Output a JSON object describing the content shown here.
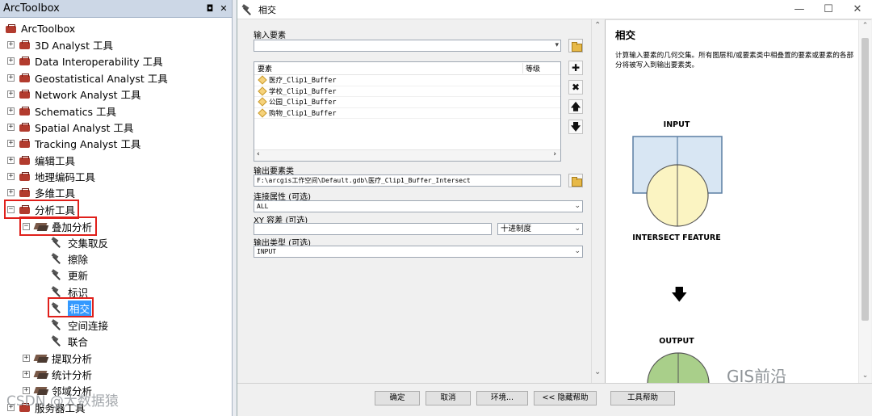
{
  "toolbox": {
    "title": "ArcToolbox",
    "title_buttons": [
      "◘",
      "✕"
    ],
    "root": "ArcToolbox",
    "items": [
      "3D Analyst 工具",
      "Data Interoperability 工具",
      "Geostatistical Analyst 工具",
      "Network Analyst 工具",
      "Schematics 工具",
      "Spatial Analyst 工具",
      "Tracking Analyst 工具",
      "编辑工具",
      "地理编码工具",
      "多维工具",
      "分析工具"
    ],
    "overlay_set": "叠加分析",
    "overlay_tools": [
      "交集取反",
      "擦除",
      "更新",
      "标识",
      "相交",
      "空间连接",
      "联合"
    ],
    "other_sets": [
      "提取分析",
      "统计分析",
      "邻域分析"
    ],
    "last_item": "服务器工具"
  },
  "dialog": {
    "title": "相交",
    "window_buttons": [
      "—",
      "☐",
      "✕"
    ],
    "input_features_label": "输入要素",
    "input_features_value": "",
    "list_header_feature": "要素",
    "list_header_rank": "等级",
    "list_rows": [
      "医疗_Clip1_Buffer",
      "学校_Clip1_Buffer",
      "公园_Clip1_Buffer",
      "购物_Clip1_Buffer"
    ],
    "side_buttons": [
      "✚",
      "✖",
      "🡅",
      "🡇"
    ],
    "output_label": "输出要素类",
    "output_value": "F:\\arcgis工作空间\\Default.gdb\\医疗_Clip1_Buffer_Intersect",
    "join_label": "连接属性 (可选)",
    "join_value": "ALL",
    "xy_label": "XY 容差 (可选)",
    "xy_value": "",
    "xy_unit": "十进制度",
    "output_type_label": "输出类型 (可选)",
    "output_type_value": "INPUT",
    "buttons": {
      "ok": "确定",
      "cancel": "取消",
      "env": "环境...",
      "hide_help": "<< 隐藏帮助",
      "tool_help": "工具帮助"
    }
  },
  "help": {
    "title": "相交",
    "description": "计算输入要素的几何交集。所有图层和/或要素类中相叠置的要素或要素的各部分将被写入到输出要素类。",
    "label_input": "INPUT",
    "label_intersect": "INTERSECT FEATURE",
    "label_output": "OUTPUT"
  },
  "watermarks": {
    "gis": "GIS前沿",
    "csdn": "CSDN @大数据猿"
  }
}
